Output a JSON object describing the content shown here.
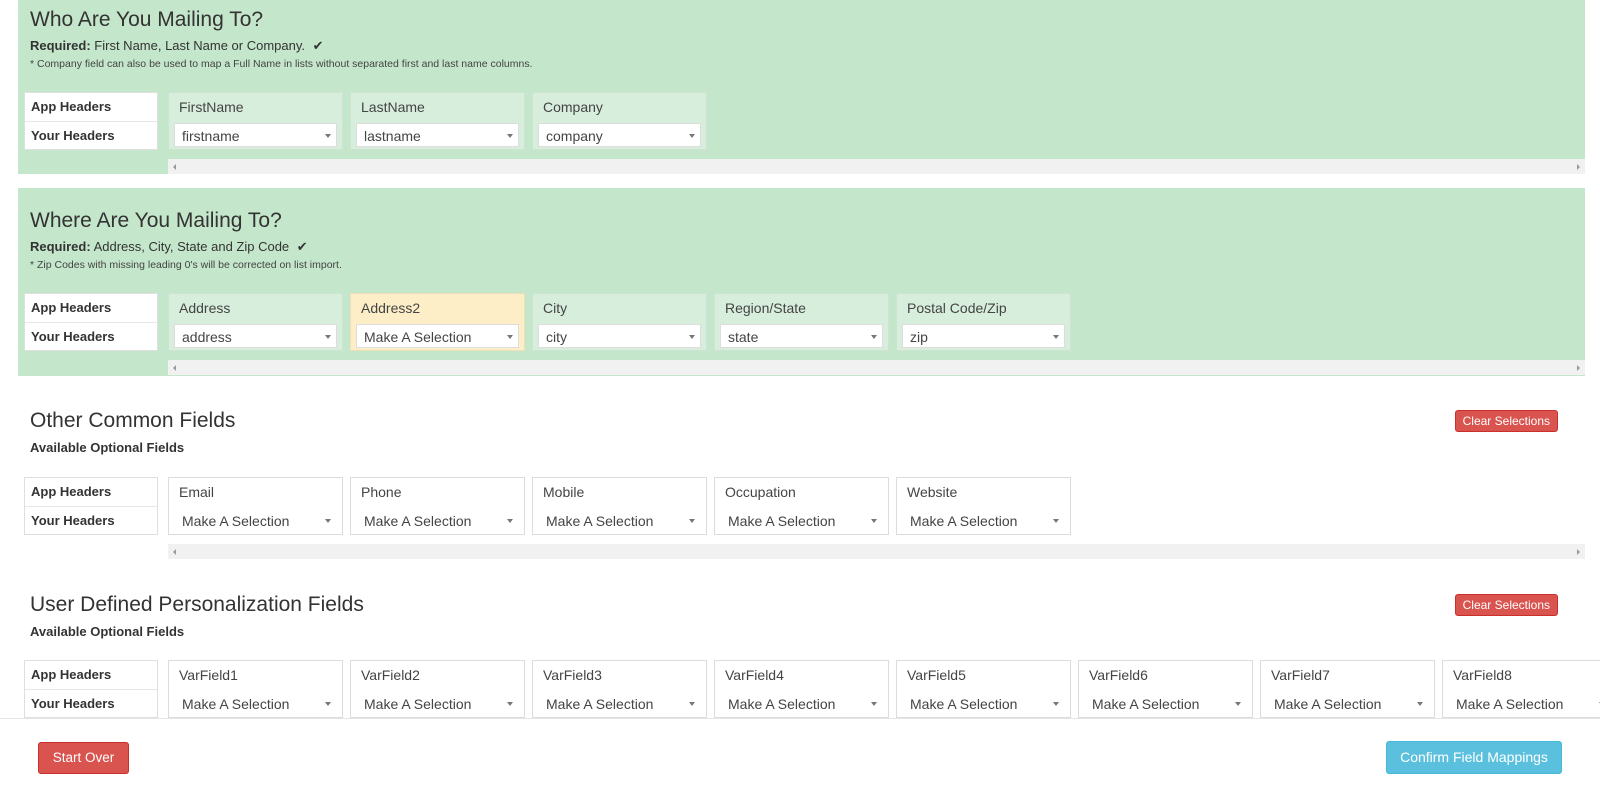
{
  "common": {
    "app_headers_label": "App Headers",
    "your_headers_label": "Your Headers",
    "clear_label": "Clear Selections"
  },
  "who": {
    "title": "Who Are You Mailing To?",
    "required_label": "Required:",
    "required_text": "First Name, Last Name or Company.",
    "note": "* Company field can also be used to map a Full Name in lists without separated first and last name columns.",
    "fields": [
      {
        "header": "FirstName",
        "value": "firstname"
      },
      {
        "header": "LastName",
        "value": "lastname"
      },
      {
        "header": "Company",
        "value": "company"
      }
    ]
  },
  "where": {
    "title": "Where Are You Mailing To?",
    "required_label": "Required:",
    "required_text": "Address, City, State and Zip Code",
    "note": "* Zip Codes with missing leading 0's will be corrected on list import.",
    "fields": [
      {
        "header": "Address",
        "value": "address"
      },
      {
        "header": "Address2",
        "value": "Make A Selection"
      },
      {
        "header": "City",
        "value": "city"
      },
      {
        "header": "Region/State",
        "value": "state"
      },
      {
        "header": "Postal Code/Zip",
        "value": "zip"
      }
    ]
  },
  "other": {
    "title": "Other Common Fields",
    "subtitle": "Available Optional Fields",
    "fields": [
      {
        "header": "Email",
        "value": "Make A Selection"
      },
      {
        "header": "Phone",
        "value": "Make A Selection"
      },
      {
        "header": "Mobile",
        "value": "Make A Selection"
      },
      {
        "header": "Occupation",
        "value": "Make A Selection"
      },
      {
        "header": "Website",
        "value": "Make A Selection"
      }
    ]
  },
  "user": {
    "title": "User Defined Personalization Fields",
    "subtitle": "Available Optional Fields",
    "fields": [
      {
        "header": "VarField1",
        "value": "Make A Selection"
      },
      {
        "header": "VarField2",
        "value": "Make A Selection"
      },
      {
        "header": "VarField3",
        "value": "Make A Selection"
      },
      {
        "header": "VarField4",
        "value": "Make A Selection"
      },
      {
        "header": "VarField5",
        "value": "Make A Selection"
      },
      {
        "header": "VarField6",
        "value": "Make A Selection"
      },
      {
        "header": "VarField7",
        "value": "Make A Selection"
      },
      {
        "header": "VarField8",
        "value": "Make A Selection"
      }
    ]
  },
  "footer": {
    "start_over": "Start Over",
    "confirm": "Confirm Field Mappings"
  },
  "colors": {
    "required_bg": "#c4e6cb",
    "warning_field_bg": "#fdeec8",
    "danger": "#d9534f",
    "info": "#5bc0de"
  }
}
